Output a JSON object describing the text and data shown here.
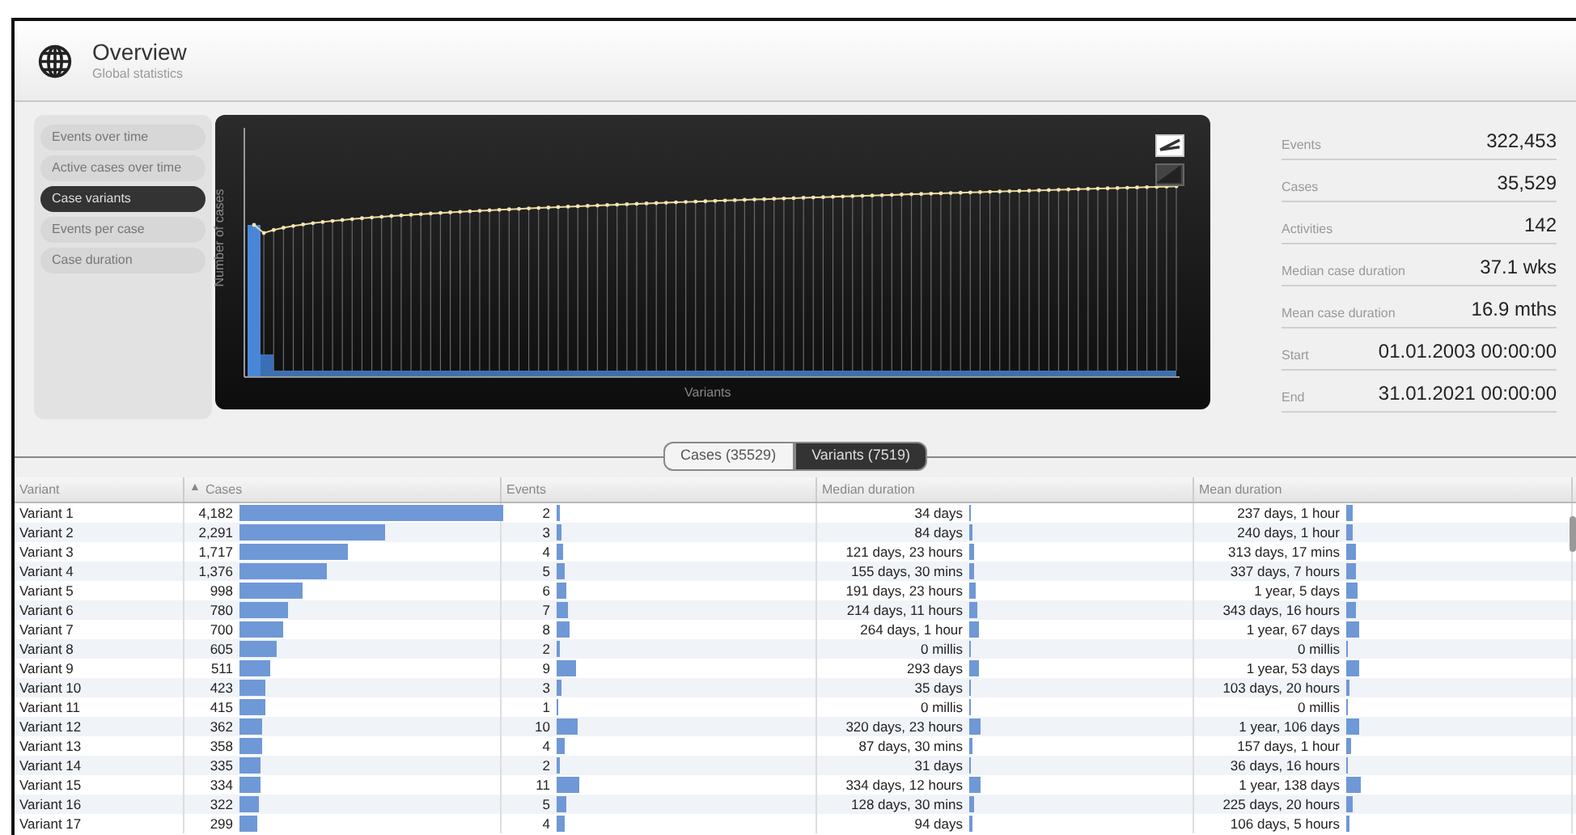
{
  "header": {
    "title": "Overview",
    "subtitle": "Global statistics"
  },
  "chart_menu": [
    {
      "label": "Events over time",
      "selected": false
    },
    {
      "label": "Active cases over time",
      "selected": false
    },
    {
      "label": "Case variants",
      "selected": true
    },
    {
      "label": "Events per case",
      "selected": false
    },
    {
      "label": "Case duration",
      "selected": false
    }
  ],
  "chart": {
    "ylabel": "Number of cases",
    "xlabel": "Variants",
    "view_buttons": [
      {
        "kind": "line",
        "selected": true
      },
      {
        "kind": "area",
        "selected": false
      }
    ]
  },
  "stats": [
    {
      "label": "Events",
      "value": "322,453"
    },
    {
      "label": "Cases",
      "value": "35,529"
    },
    {
      "label": "Activities",
      "value": "142"
    },
    {
      "label": "Median case duration",
      "value": "37.1 wks"
    },
    {
      "label": "Mean case duration",
      "value": "16.9 mths"
    },
    {
      "label": "Start",
      "value": "01.01.2003 00:00:00"
    },
    {
      "label": "End",
      "value": "31.01.2021 00:00:00"
    }
  ],
  "view_tabs": [
    {
      "label": "Cases (35529)",
      "selected": false
    },
    {
      "label": "Variants (7519)",
      "selected": true
    }
  ],
  "table": {
    "columns": [
      {
        "label": "Variant"
      },
      {
        "label": "Cases",
        "sort_mark": "▲"
      },
      {
        "label": "Events"
      },
      {
        "label": "Median duration"
      },
      {
        "label": "Mean duration"
      }
    ],
    "rows": [
      {
        "variant": "Variant 1",
        "cases": "4,182",
        "events": "2",
        "median": "34 days",
        "mean": "237 days, 1 hour"
      },
      {
        "variant": "Variant 2",
        "cases": "2,291",
        "events": "3",
        "median": "84 days",
        "mean": "240 days, 1 hour"
      },
      {
        "variant": "Variant 3",
        "cases": "1,717",
        "events": "4",
        "median": "121 days, 23 hours",
        "mean": "313 days, 17 mins"
      },
      {
        "variant": "Variant 4",
        "cases": "1,376",
        "events": "5",
        "median": "155 days, 30 mins",
        "mean": "337 days, 7 hours"
      },
      {
        "variant": "Variant 5",
        "cases": "998",
        "events": "6",
        "median": "191 days, 23 hours",
        "mean": "1 year, 5 days"
      },
      {
        "variant": "Variant 6",
        "cases": "780",
        "events": "7",
        "median": "214 days, 11 hours",
        "mean": "343 days, 16 hours"
      },
      {
        "variant": "Variant 7",
        "cases": "700",
        "events": "8",
        "median": "264 days, 1 hour",
        "mean": "1 year, 67 days"
      },
      {
        "variant": "Variant 8",
        "cases": "605",
        "events": "2",
        "median": "0 millis",
        "mean": "0 millis"
      },
      {
        "variant": "Variant 9",
        "cases": "511",
        "events": "9",
        "median": "293 days",
        "mean": "1 year, 53 days"
      },
      {
        "variant": "Variant 10",
        "cases": "423",
        "events": "3",
        "median": "35 days",
        "mean": "103 days, 20 hours"
      },
      {
        "variant": "Variant 11",
        "cases": "415",
        "events": "1",
        "median": "0 millis",
        "mean": "0 millis"
      },
      {
        "variant": "Variant 12",
        "cases": "362",
        "events": "10",
        "median": "320 days, 23 hours",
        "mean": "1 year, 106 days"
      },
      {
        "variant": "Variant 13",
        "cases": "358",
        "events": "4",
        "median": "87 days, 30 mins",
        "mean": "157 days, 1 hour"
      },
      {
        "variant": "Variant 14",
        "cases": "335",
        "events": "2",
        "median": "31 days",
        "mean": "36 days, 16 hours"
      },
      {
        "variant": "Variant 15",
        "cases": "334",
        "events": "11",
        "median": "334 days, 12 hours",
        "mean": "1 year, 138 days"
      },
      {
        "variant": "Variant 16",
        "cases": "322",
        "events": "5",
        "median": "128 days, 30 mins",
        "mean": "225 days, 20 hours"
      },
      {
        "variant": "Variant 17",
        "cases": "299",
        "events": "4",
        "median": "94 days",
        "mean": "106 days, 5 hours"
      }
    ]
  }
}
